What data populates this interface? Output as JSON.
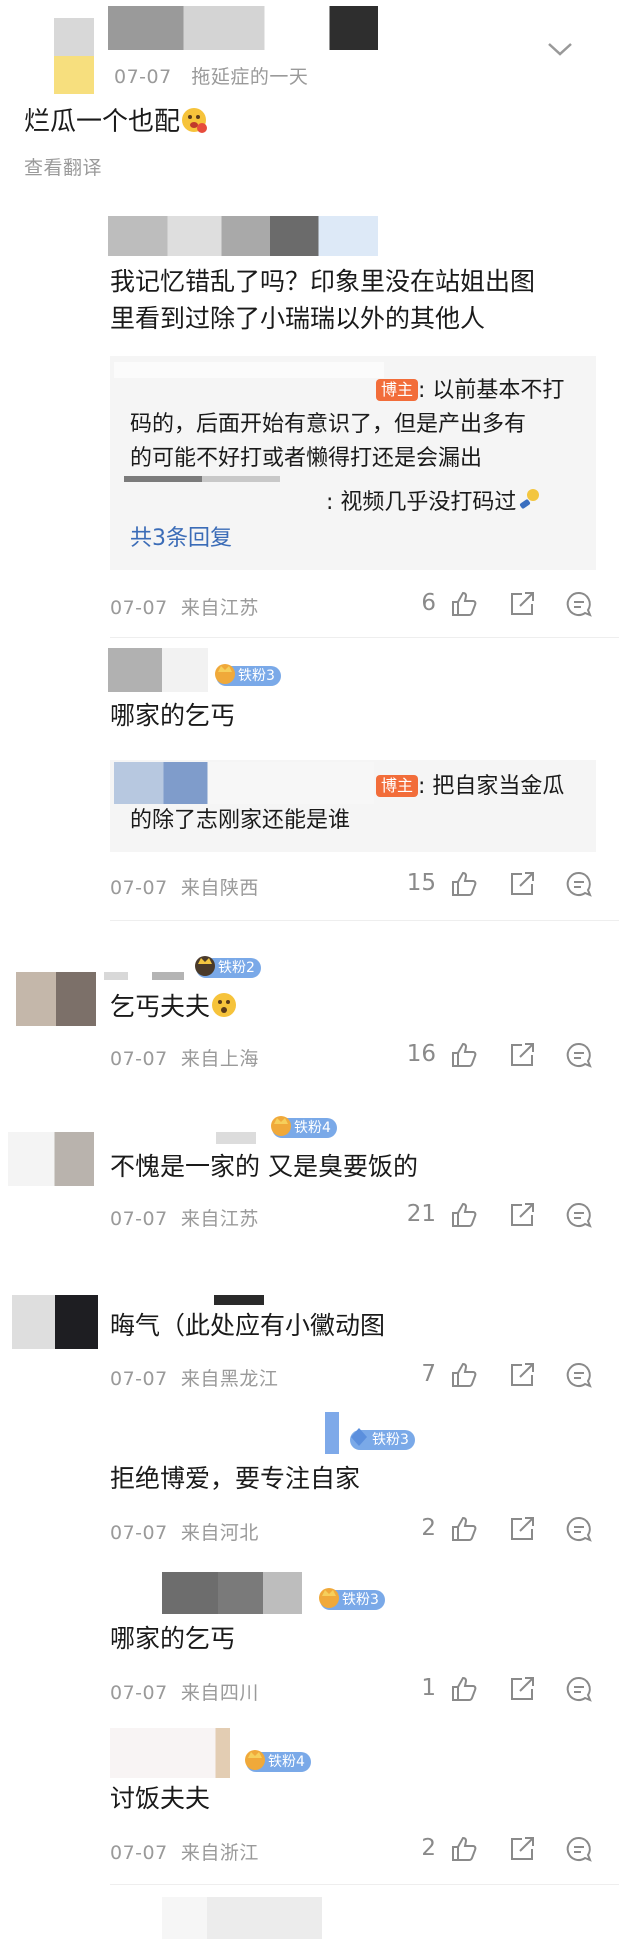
{
  "top": {
    "date": "07-07",
    "source": "拖延症的一天",
    "text": "烂瓜一个也配",
    "translate": "查看翻译"
  },
  "comments": [
    {
      "text_line1": "我记忆错乱了吗？印象里没在站姐出图",
      "text_line2": "里看到过除了小瑞瑞以外的其他人",
      "reply_tag": "博主",
      "reply_line1": ": 以前基本不打",
      "reply_line2": "码的，后面开始有意识了，但是产出多有",
      "reply_line3": "的可能不好打或者懒得打还是会漏出",
      "reply_line4": ": 视频几乎没打码过",
      "more_replies": "共3条回复",
      "date": "07-07",
      "location": "来自江苏",
      "likes": "6"
    },
    {
      "badge": "铁粉3",
      "text": "哪家的乞丐",
      "reply_tag": "博主",
      "reply_line1": ": 把自家当金瓜",
      "reply_line2": "的除了志刚家还能是谁",
      "date": "07-07",
      "location": "来自陕西",
      "likes": "15"
    },
    {
      "badge": "铁粉2",
      "text": "乞丐夫夫",
      "date": "07-07",
      "location": "来自上海",
      "likes": "16"
    },
    {
      "badge": "铁粉4",
      "text": "不愧是一家的 又是臭要饭的",
      "date": "07-07",
      "location": "来自江苏",
      "likes": "21"
    },
    {
      "text": "晦气（此处应有小黴动图",
      "date": "07-07",
      "location": "来自黑龙江",
      "likes": "7"
    },
    {
      "badge": "铁粉3",
      "text": "拒绝博爱，要专注自家",
      "date": "07-07",
      "location": "来自河北",
      "likes": "2"
    },
    {
      "badge": "铁粉3",
      "text": "哪家的乞丐",
      "date": "07-07",
      "location": "来自四川",
      "likes": "1"
    },
    {
      "badge": "铁粉4",
      "text": "讨饭夫夫",
      "date": "07-07",
      "location": "来自浙江",
      "likes": "2"
    }
  ],
  "colors": {
    "bozhu": "#f26d3a",
    "badge": "#7aa9e8",
    "meta": "#9a9a9a",
    "link": "#3b6cb7"
  },
  "icons": [
    "chevron-down-icon",
    "like-icon",
    "share-icon",
    "comment-icon",
    "emoji-icon",
    "crown-icon"
  ]
}
